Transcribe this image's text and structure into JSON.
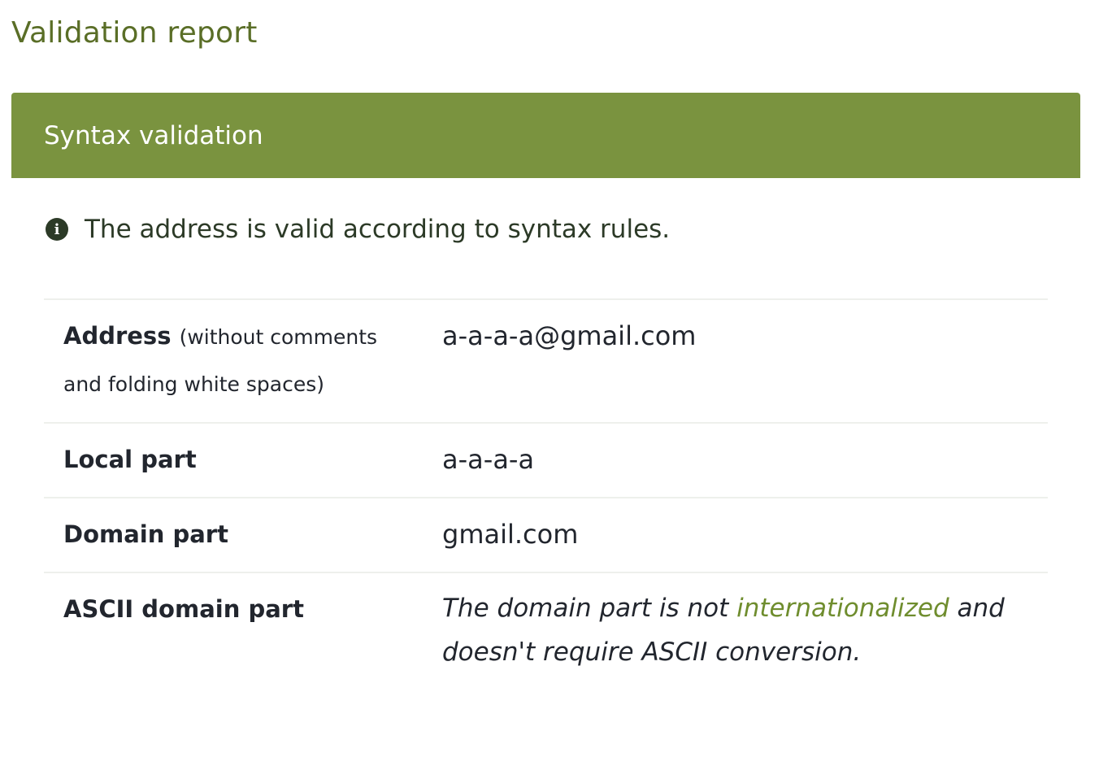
{
  "page": {
    "title": "Validation report"
  },
  "card": {
    "header": "Syntax validation",
    "notice": "The address is valid according to syntax rules.",
    "icon": "info-circle-icon"
  },
  "details": {
    "address": {
      "label": "Address",
      "note": "(without comments and folding white spaces)",
      "value": "a-a-a-a@gmail.com"
    },
    "local_part": {
      "label": "Local part",
      "value": "a-a-a-a"
    },
    "domain_part": {
      "label": "Domain part",
      "value": "gmail.com"
    },
    "ascii_domain_part": {
      "label": "ASCII domain part",
      "value_before": "The domain part is not",
      "link_text": "internationalized",
      "value_after": "and doesn't require ASCII conversion."
    }
  },
  "colors": {
    "accent": "#7a933f",
    "title": "#5a6e27",
    "link": "#6f8d2e",
    "text": "#22262e"
  }
}
